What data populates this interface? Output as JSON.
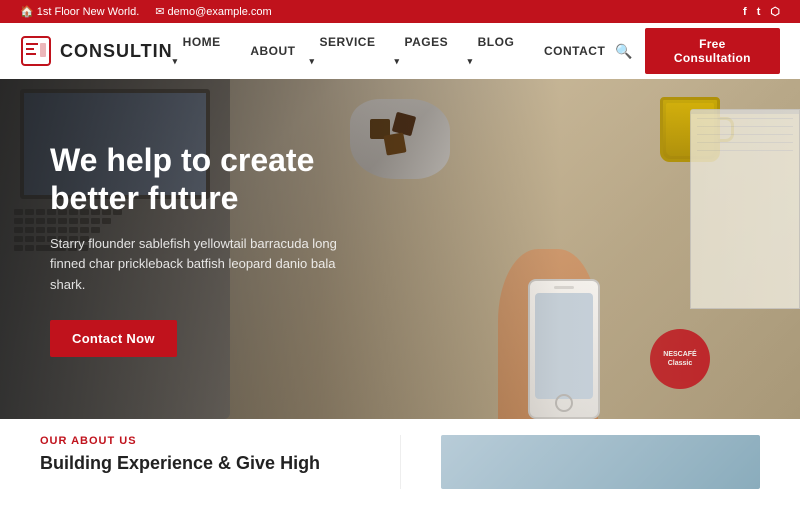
{
  "topbar": {
    "address": "1st Floor New World.",
    "email": "demo@example.com",
    "address_icon": "🏠",
    "email_icon": "✉",
    "social": [
      "f",
      "t",
      "in"
    ]
  },
  "navbar": {
    "logo_text": "CONSULTIN",
    "nav_items": [
      {
        "label": "HOME",
        "has_dropdown": true
      },
      {
        "label": "ABOUT",
        "has_dropdown": false
      },
      {
        "label": "SERVICE",
        "has_dropdown": true
      },
      {
        "label": "PAGES",
        "has_dropdown": true
      },
      {
        "label": "BLOG",
        "has_dropdown": true
      },
      {
        "label": "CONTACT",
        "has_dropdown": false
      }
    ],
    "cta_label": "Free Consultation"
  },
  "hero": {
    "title_line1": "We help to create",
    "title_line2": "better future",
    "subtitle": "Starry flounder sablefish yellowtail barracuda long finned char prickleback batfish leopard danio bala shark.",
    "cta_label": "Contact Now"
  },
  "about_section": {
    "section_label": "OUR ABOUT US",
    "title": "Building Experience & Give High"
  }
}
